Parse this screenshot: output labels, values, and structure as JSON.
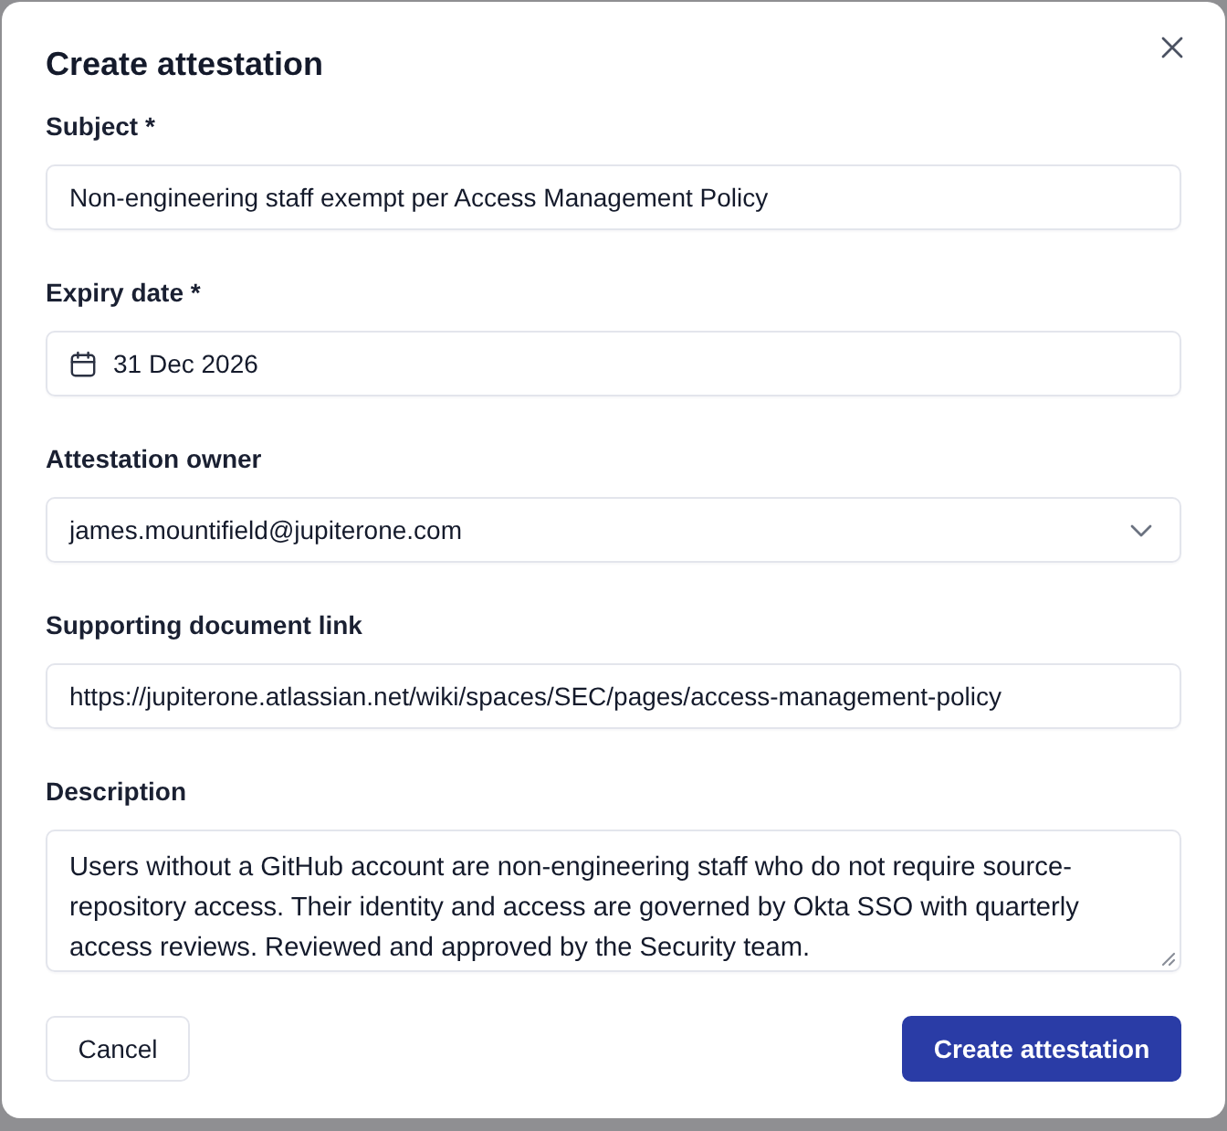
{
  "dialog": {
    "title": "Create attestation"
  },
  "fields": [
    {
      "kind": "text",
      "label": "Subject *",
      "value": "Non-engineering staff exempt per Access Management Policy"
    },
    {
      "kind": "date",
      "label": "Expiry date *",
      "value": "31 Dec 2026"
    },
    {
      "kind": "select",
      "label": "Attestation owner",
      "value": "james.mountifield@jupiterone.com"
    },
    {
      "kind": "text",
      "label": "Supporting document link",
      "value": "https://jupiterone.atlassian.net/wiki/spaces/SEC/pages/access-management-policy"
    },
    {
      "kind": "textarea",
      "label": "Description",
      "value": "Users without a GitHub account are non-engineering staff who do not require source-repository access. Their identity and access are governed by Okta SSO with quarterly access reviews. Reviewed and approved by the Security team."
    }
  ],
  "buttons": [
    {
      "kind": "secondary",
      "label": "Cancel"
    },
    {
      "kind": "primary",
      "label": "Create attestation"
    }
  ]
}
